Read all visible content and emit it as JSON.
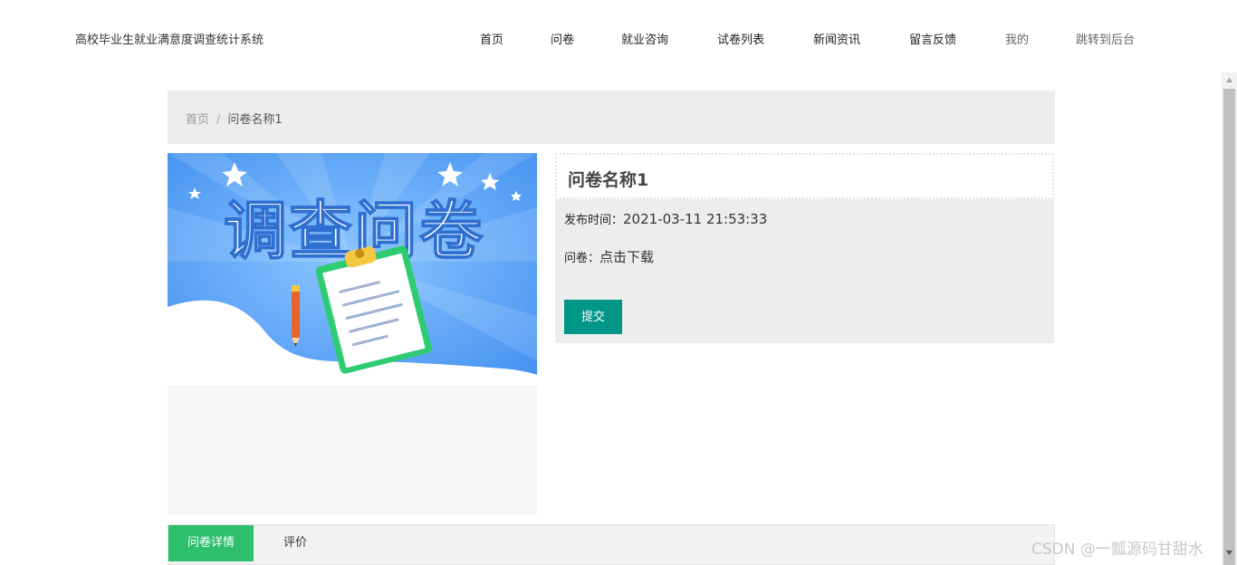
{
  "site": {
    "title": "高校毕业生就业满意度调查统计系统"
  },
  "nav": {
    "items": [
      {
        "label": "首页"
      },
      {
        "label": "问卷"
      },
      {
        "label": "就业咨询"
      },
      {
        "label": "试卷列表"
      },
      {
        "label": "新闻资讯"
      },
      {
        "label": "留言反馈"
      },
      {
        "label": "我的"
      },
      {
        "label": "跳转到后台"
      }
    ]
  },
  "breadcrumb": {
    "home": "首页",
    "separator": "/",
    "current": "问卷名称1"
  },
  "banner": {
    "text": "调查问卷"
  },
  "detail": {
    "title": "问卷名称1",
    "publish_label": "发布时间：",
    "publish_time": "2021-03-11 21:53:33",
    "file_label": "问卷：",
    "file_link": "点击下载",
    "submit_label": "提交"
  },
  "tabs": [
    {
      "label": "问卷详情"
    },
    {
      "label": "评价"
    }
  ],
  "watermark": "CSDN @一瓢源码甘甜水",
  "colors": {
    "primary": "#009688",
    "tab_active": "#2dbf6c",
    "banner_blue": "#4a97f3"
  }
}
